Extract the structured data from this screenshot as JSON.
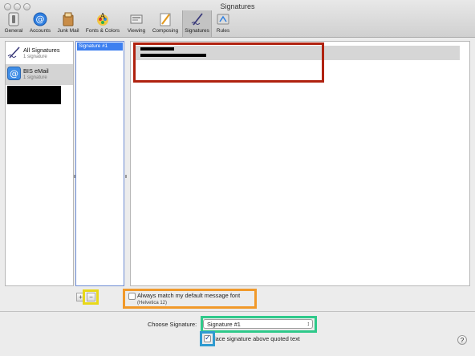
{
  "window": {
    "title": "Signatures"
  },
  "toolbar": {
    "items": [
      {
        "label": "General",
        "icon": "general-switch-icon"
      },
      {
        "label": "Accounts",
        "icon": "at-sign-icon"
      },
      {
        "label": "Junk Mail",
        "icon": "junk-mail-icon"
      },
      {
        "label": "Fonts & Colors",
        "icon": "fonts-colors-icon"
      },
      {
        "label": "Viewing",
        "icon": "viewing-icon"
      },
      {
        "label": "Composing",
        "icon": "composing-pencil-icon"
      },
      {
        "label": "Signatures",
        "icon": "signature-pen-icon",
        "selected": true
      },
      {
        "label": "Rules",
        "icon": "rules-icon"
      }
    ]
  },
  "accounts": [
    {
      "name": "All Signatures",
      "count": "1 signature",
      "icon": "signature-pen-icon"
    },
    {
      "name": "BIS eMail",
      "count": "1 signature",
      "icon": "at-sign-icon"
    }
  ],
  "signatures": {
    "items": [
      "Signature #1"
    ]
  },
  "editor": {},
  "options": {
    "match_font_label": "Always match my default message font",
    "match_font_checked": false,
    "font_hint": "(Helvetica 12)",
    "choose_label": "Choose Signature:",
    "choose_value": "Signature #1",
    "place_above_label": "lace signature above quoted text",
    "place_above_checked": true,
    "add_button": "+",
    "remove_button": "−",
    "help": "?"
  },
  "colors": {
    "annotation_red": "#b0220f",
    "annotation_yellow": "#e8d81a",
    "annotation_orange": "#f1992a",
    "annotation_green": "#2ec98a",
    "annotation_blue": "#2f9bd0",
    "selection_blue": "#3d7ff0"
  }
}
